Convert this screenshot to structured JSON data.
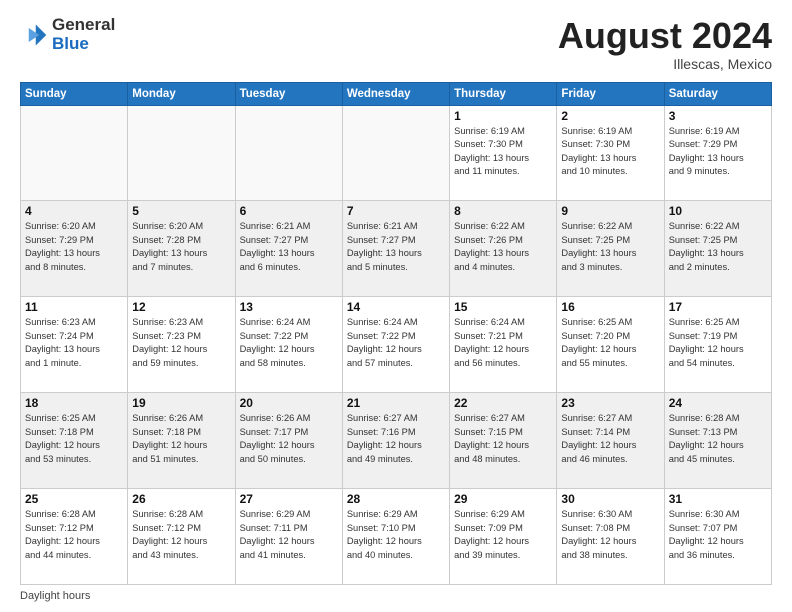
{
  "logo": {
    "general": "General",
    "blue": "Blue"
  },
  "header": {
    "month_year": "August 2024",
    "location": "Illescas, Mexico"
  },
  "days_of_week": [
    "Sunday",
    "Monday",
    "Tuesday",
    "Wednesday",
    "Thursday",
    "Friday",
    "Saturday"
  ],
  "weeks": [
    [
      {
        "day": "",
        "info": "",
        "empty": true
      },
      {
        "day": "",
        "info": "",
        "empty": true
      },
      {
        "day": "",
        "info": "",
        "empty": true
      },
      {
        "day": "",
        "info": "",
        "empty": true
      },
      {
        "day": "1",
        "info": "Sunrise: 6:19 AM\nSunset: 7:30 PM\nDaylight: 13 hours\nand 11 minutes."
      },
      {
        "day": "2",
        "info": "Sunrise: 6:19 AM\nSunset: 7:30 PM\nDaylight: 13 hours\nand 10 minutes."
      },
      {
        "day": "3",
        "info": "Sunrise: 6:19 AM\nSunset: 7:29 PM\nDaylight: 13 hours\nand 9 minutes."
      }
    ],
    [
      {
        "day": "4",
        "info": "Sunrise: 6:20 AM\nSunset: 7:29 PM\nDaylight: 13 hours\nand 8 minutes."
      },
      {
        "day": "5",
        "info": "Sunrise: 6:20 AM\nSunset: 7:28 PM\nDaylight: 13 hours\nand 7 minutes."
      },
      {
        "day": "6",
        "info": "Sunrise: 6:21 AM\nSunset: 7:27 PM\nDaylight: 13 hours\nand 6 minutes."
      },
      {
        "day": "7",
        "info": "Sunrise: 6:21 AM\nSunset: 7:27 PM\nDaylight: 13 hours\nand 5 minutes."
      },
      {
        "day": "8",
        "info": "Sunrise: 6:22 AM\nSunset: 7:26 PM\nDaylight: 13 hours\nand 4 minutes."
      },
      {
        "day": "9",
        "info": "Sunrise: 6:22 AM\nSunset: 7:25 PM\nDaylight: 13 hours\nand 3 minutes."
      },
      {
        "day": "10",
        "info": "Sunrise: 6:22 AM\nSunset: 7:25 PM\nDaylight: 13 hours\nand 2 minutes."
      }
    ],
    [
      {
        "day": "11",
        "info": "Sunrise: 6:23 AM\nSunset: 7:24 PM\nDaylight: 13 hours\nand 1 minute."
      },
      {
        "day": "12",
        "info": "Sunrise: 6:23 AM\nSunset: 7:23 PM\nDaylight: 12 hours\nand 59 minutes."
      },
      {
        "day": "13",
        "info": "Sunrise: 6:24 AM\nSunset: 7:22 PM\nDaylight: 12 hours\nand 58 minutes."
      },
      {
        "day": "14",
        "info": "Sunrise: 6:24 AM\nSunset: 7:22 PM\nDaylight: 12 hours\nand 57 minutes."
      },
      {
        "day": "15",
        "info": "Sunrise: 6:24 AM\nSunset: 7:21 PM\nDaylight: 12 hours\nand 56 minutes."
      },
      {
        "day": "16",
        "info": "Sunrise: 6:25 AM\nSunset: 7:20 PM\nDaylight: 12 hours\nand 55 minutes."
      },
      {
        "day": "17",
        "info": "Sunrise: 6:25 AM\nSunset: 7:19 PM\nDaylight: 12 hours\nand 54 minutes."
      }
    ],
    [
      {
        "day": "18",
        "info": "Sunrise: 6:25 AM\nSunset: 7:18 PM\nDaylight: 12 hours\nand 53 minutes."
      },
      {
        "day": "19",
        "info": "Sunrise: 6:26 AM\nSunset: 7:18 PM\nDaylight: 12 hours\nand 51 minutes."
      },
      {
        "day": "20",
        "info": "Sunrise: 6:26 AM\nSunset: 7:17 PM\nDaylight: 12 hours\nand 50 minutes."
      },
      {
        "day": "21",
        "info": "Sunrise: 6:27 AM\nSunset: 7:16 PM\nDaylight: 12 hours\nand 49 minutes."
      },
      {
        "day": "22",
        "info": "Sunrise: 6:27 AM\nSunset: 7:15 PM\nDaylight: 12 hours\nand 48 minutes."
      },
      {
        "day": "23",
        "info": "Sunrise: 6:27 AM\nSunset: 7:14 PM\nDaylight: 12 hours\nand 46 minutes."
      },
      {
        "day": "24",
        "info": "Sunrise: 6:28 AM\nSunset: 7:13 PM\nDaylight: 12 hours\nand 45 minutes."
      }
    ],
    [
      {
        "day": "25",
        "info": "Sunrise: 6:28 AM\nSunset: 7:12 PM\nDaylight: 12 hours\nand 44 minutes."
      },
      {
        "day": "26",
        "info": "Sunrise: 6:28 AM\nSunset: 7:12 PM\nDaylight: 12 hours\nand 43 minutes."
      },
      {
        "day": "27",
        "info": "Sunrise: 6:29 AM\nSunset: 7:11 PM\nDaylight: 12 hours\nand 41 minutes."
      },
      {
        "day": "28",
        "info": "Sunrise: 6:29 AM\nSunset: 7:10 PM\nDaylight: 12 hours\nand 40 minutes."
      },
      {
        "day": "29",
        "info": "Sunrise: 6:29 AM\nSunset: 7:09 PM\nDaylight: 12 hours\nand 39 minutes."
      },
      {
        "day": "30",
        "info": "Sunrise: 6:30 AM\nSunset: 7:08 PM\nDaylight: 12 hours\nand 38 minutes."
      },
      {
        "day": "31",
        "info": "Sunrise: 6:30 AM\nSunset: 7:07 PM\nDaylight: 12 hours\nand 36 minutes."
      }
    ]
  ],
  "footer": {
    "daylight_label": "Daylight hours"
  }
}
